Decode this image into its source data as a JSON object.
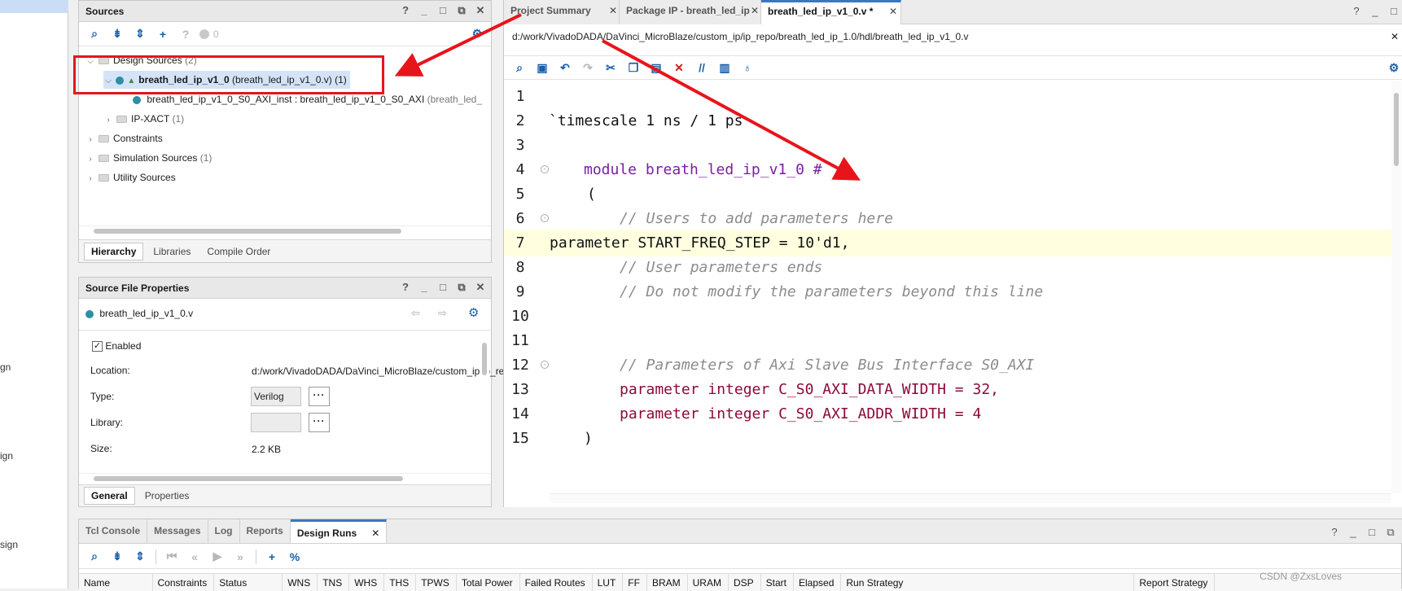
{
  "flow_navigator": {
    "fragments": [
      "gn",
      "ign",
      "sign"
    ]
  },
  "sources_panel": {
    "title": "Sources",
    "badge_count": "0",
    "tree": {
      "design_sources": {
        "label": "Design Sources",
        "count": "(2)"
      },
      "top_module": {
        "name": "breath_led_ip_v1_0",
        "detail": "(breath_led_ip_v1_0.v) (1)"
      },
      "instance": {
        "name": "breath_led_ip_v1_0_S0_AXI_inst : breath_led_ip_v1_0_S0_AXI",
        "detail": "(breath_led_"
      },
      "ip_xact": {
        "label": "IP-XACT",
        "count": "(1)"
      },
      "constraints": {
        "label": "Constraints"
      },
      "simulation_sources": {
        "label": "Simulation Sources",
        "count": "(1)"
      },
      "utility_sources": {
        "label": "Utility Sources"
      }
    },
    "tabs": [
      "Hierarchy",
      "Libraries",
      "Compile Order"
    ]
  },
  "properties_panel": {
    "title": "Source File Properties",
    "file": "breath_led_ip_v1_0.v",
    "enabled_label": "Enabled",
    "enabled_checked": true,
    "location_label": "Location:",
    "location_value": "d:/work/VivadoDADA/DaVinci_MicroBlaze/custom_ip/ip_repo/breath_",
    "type_label": "Type:",
    "type_value": "Verilog",
    "library_label": "Library:",
    "library_value": "",
    "size_label": "Size:",
    "size_value": "2.2 KB",
    "tabs": [
      "General",
      "Properties"
    ]
  },
  "editor": {
    "tabs": [
      {
        "label": "Project Summary",
        "active": false
      },
      {
        "label": "Package IP - breath_led_ip",
        "active": false
      },
      {
        "label": "breath_led_ip_v1_0.v *",
        "active": true
      }
    ],
    "path": "d:/work/VivadoDADA/DaVinci_MicroBlaze/custom_ip/ip_repo/breath_led_ip_1.0/hdl/breath_led_ip_v1_0.v",
    "lines": [
      {
        "n": "1",
        "text": ""
      },
      {
        "n": "2",
        "text": "`timescale 1 ns / 1 ps"
      },
      {
        "n": "3",
        "text": ""
      },
      {
        "n": "4",
        "text": "module breath_led_ip_v1_0 #"
      },
      {
        "n": "5",
        "text": "("
      },
      {
        "n": "6",
        "text": "// Users to add parameters here"
      },
      {
        "n": "7",
        "text": "parameter START_FREQ_STEP = 10'd1,"
      },
      {
        "n": "8",
        "text": "// User parameters ends"
      },
      {
        "n": "9",
        "text": "// Do not modify the parameters beyond this line"
      },
      {
        "n": "10",
        "text": ""
      },
      {
        "n": "11",
        "text": ""
      },
      {
        "n": "12",
        "text": "// Parameters of Axi Slave Bus Interface S0_AXI"
      },
      {
        "n": "13",
        "text": "parameter integer C_S0_AXI_DATA_WIDTH = 32,"
      },
      {
        "n": "14",
        "text": "parameter integer C_S0_AXI_ADDR_WIDTH = 4"
      },
      {
        "n": "15",
        "text": ")"
      }
    ]
  },
  "bottom_panel": {
    "tabs": [
      "Tcl Console",
      "Messages",
      "Log",
      "Reports",
      "Design Runs"
    ],
    "active_tab": "Design Runs",
    "columns": [
      "Name",
      "Constraints",
      "Status",
      "WNS",
      "TNS",
      "WHS",
      "THS",
      "TPWS",
      "Total Power",
      "Failed Routes",
      "LUT",
      "FF",
      "BRAM",
      "URAM",
      "DSP",
      "Start",
      "Elapsed",
      "Run Strategy",
      "Report Strategy"
    ]
  },
  "watermark": "CSDN @ZxsLoves",
  "colors": {
    "annotation_red": "#e8141c",
    "active_tab": "#3a77c2",
    "highlight_line": "#ffffe0"
  }
}
